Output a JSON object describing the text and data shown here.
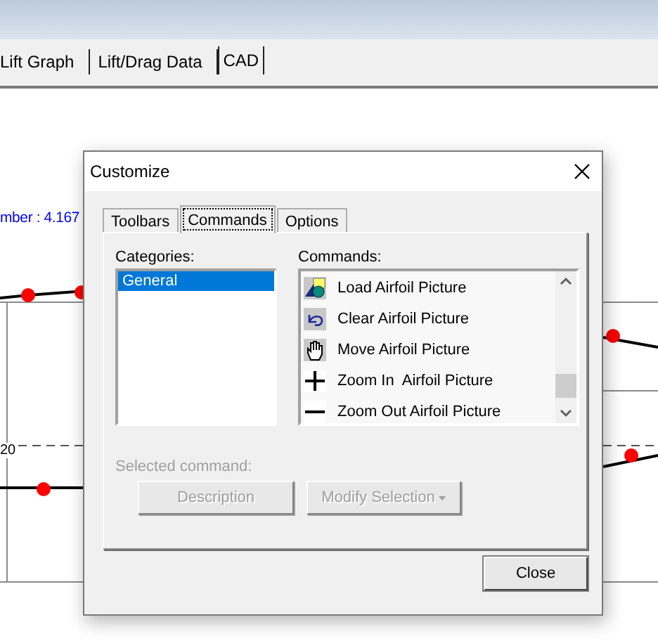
{
  "app_tabs": [
    {
      "label": "Lift Graph",
      "selected": false
    },
    {
      "label": "Lift/Drag Data",
      "selected": false
    },
    {
      "label": "CAD",
      "selected": true
    }
  ],
  "graph": {
    "label": "mber : 4.167",
    "tick": "20"
  },
  "dialog": {
    "title": "Customize",
    "tabs": [
      {
        "label": "Toolbars",
        "selected": false
      },
      {
        "label": "Commands",
        "selected": true
      },
      {
        "label": "Options",
        "selected": false
      }
    ],
    "categories_label": "Categories:",
    "categories": [
      {
        "label": "General",
        "selected": true
      }
    ],
    "commands_label": "Commands:",
    "commands": [
      {
        "label": "Load Airfoil Picture",
        "kind": "load"
      },
      {
        "label": "Clear Airfoil Picture",
        "kind": "clear"
      },
      {
        "label": "Move Airfoil Picture",
        "kind": "move"
      },
      {
        "label": "Zoom In  Airfoil Picture",
        "kind": "zoom_in"
      },
      {
        "label": "Zoom Out Airfoil Picture",
        "kind": "zoom_out"
      }
    ],
    "selected_command_label": "Selected command:",
    "buttons": [
      {
        "label": "Description",
        "kind": "plain",
        "disabled": true
      },
      {
        "label": "Modify Selection",
        "kind": "menu",
        "disabled": true
      }
    ],
    "close_button": "Close"
  }
}
